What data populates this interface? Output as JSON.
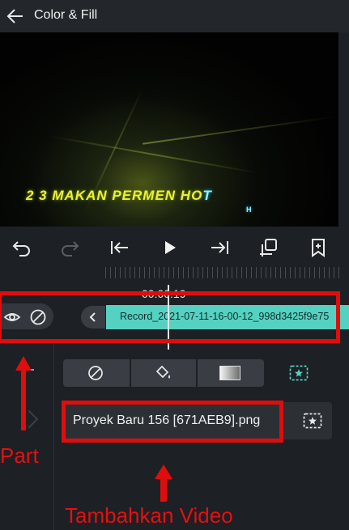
{
  "header": {
    "title": "Color & Fill"
  },
  "preview": {
    "overlay_text_main": "2 3 MAKAN PERMEN HO",
    "overlay_text_end": "T",
    "overlay_text_sub": "H"
  },
  "toolbar": {
    "icons": [
      "undo-icon",
      "redo-icon",
      "skip-start-icon",
      "play-icon",
      "skip-end-icon",
      "pip-icon",
      "add-keyframe-icon"
    ]
  },
  "timeline": {
    "current_time": "00:00:19",
    "clip_name": "Record_2021-07-11-16-00-12_998d3425f9e75"
  },
  "fill_tabs": [
    "none",
    "fill-bucket",
    "gradient",
    "image"
  ],
  "fill_file": {
    "name": "Proyek Baru 156 [671AEB9].png"
  },
  "annotations": {
    "part_label": "Part",
    "add_video_label": "Tambahkan Video"
  },
  "colors": {
    "accent_teal": "#55d1c2",
    "annotation_red": "#e00d0d",
    "overlay_yellow": "#e9f03a"
  }
}
